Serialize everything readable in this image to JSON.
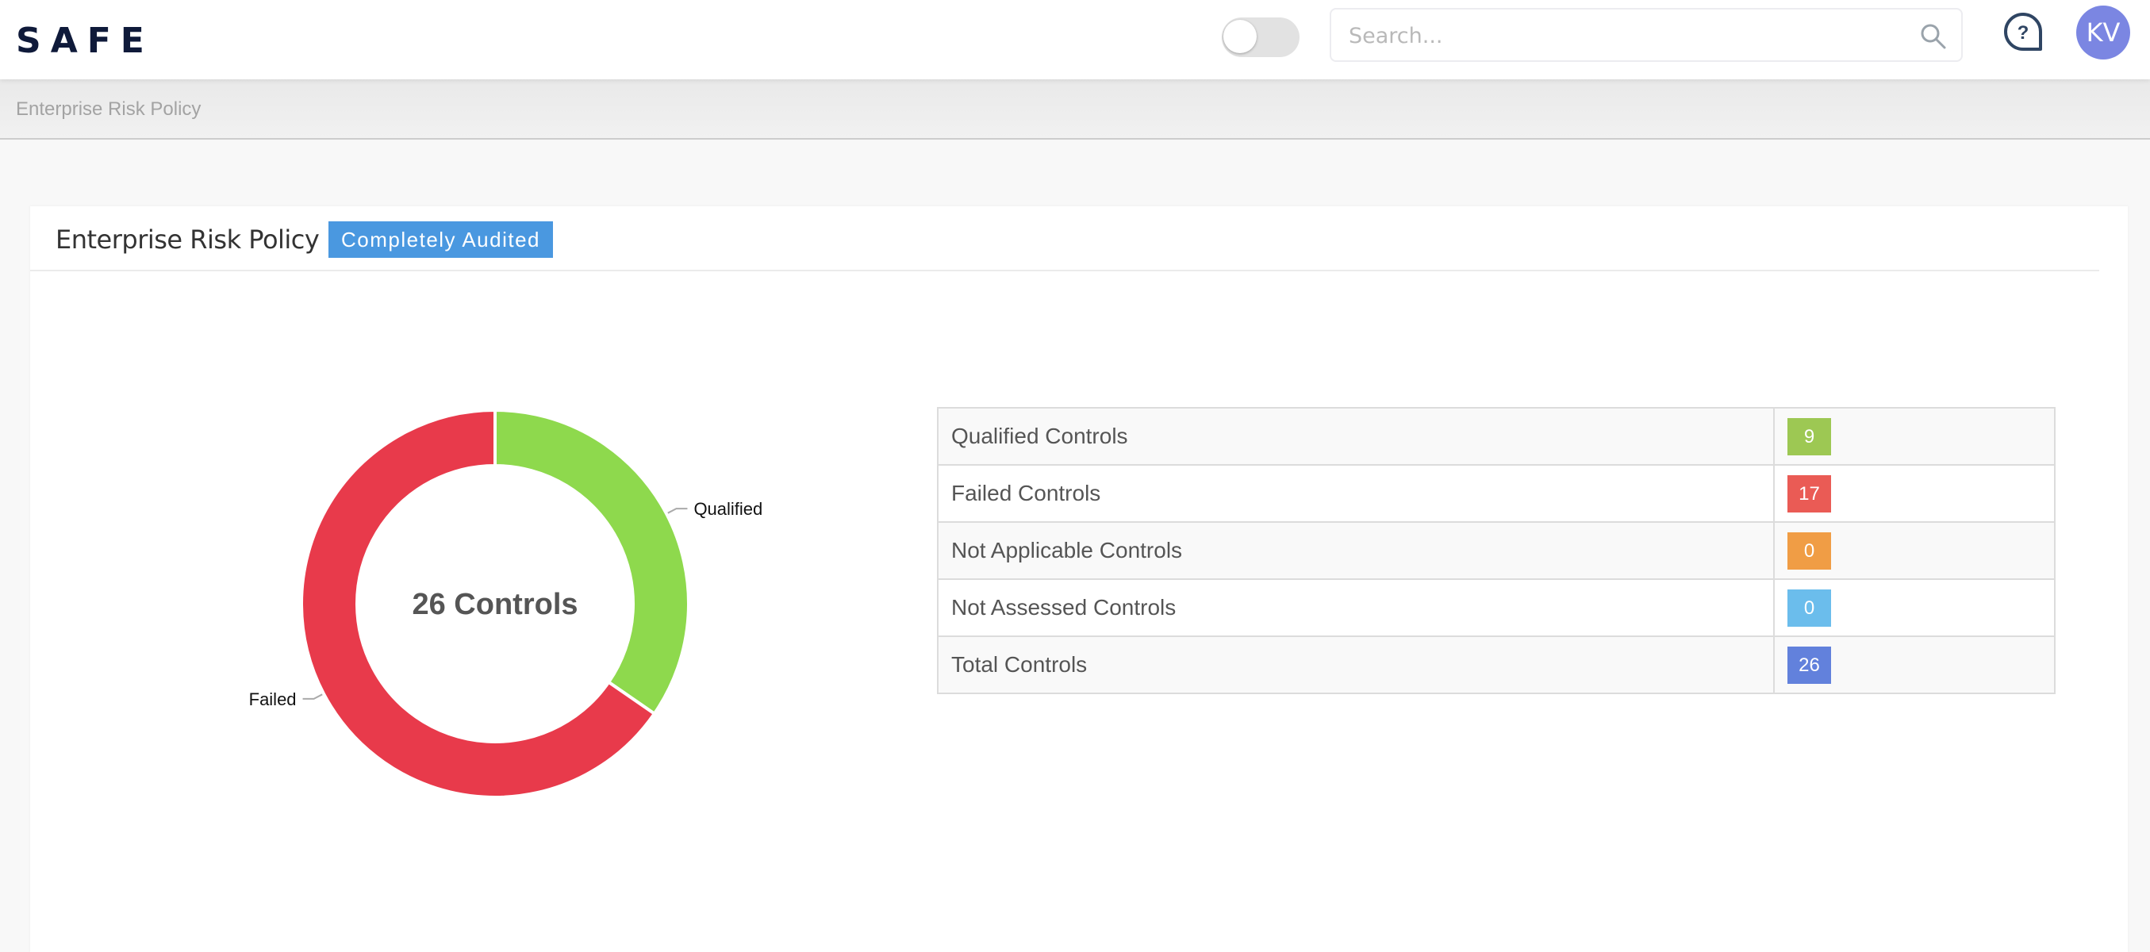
{
  "header": {
    "logo": "SAFE",
    "toggle_on": false,
    "search": {
      "value": "",
      "placeholder": "Search..."
    },
    "help_icon": "help-bubble-icon",
    "avatar_initials": "KV",
    "avatar_color": "#7b86e2"
  },
  "breadcrumb": [
    "Enterprise Risk Policy"
  ],
  "card": {
    "title": "Enterprise Risk Policy",
    "status_badge": "Completely Audited",
    "status_color": "#4a98e0"
  },
  "chart_data": {
    "type": "pie",
    "variant": "donut",
    "center_label": "26 Controls",
    "categories": [
      "Qualified",
      "Failed"
    ],
    "values": [
      9,
      17
    ],
    "colors": [
      "#8ed94d",
      "#e83a4b"
    ],
    "total": 26,
    "legend": "labels-outside"
  },
  "summary_table": {
    "rows": [
      {
        "label": "Qualified Controls",
        "value": "9",
        "color": "#9dc853"
      },
      {
        "label": "Failed Controls",
        "value": "17",
        "color": "#ea5b55"
      },
      {
        "label": "Not Applicable Controls",
        "value": "0",
        "color": "#f09d45"
      },
      {
        "label": "Not Assessed Controls",
        "value": "0",
        "color": "#6bbdec"
      },
      {
        "label": "Total Controls",
        "value": "26",
        "color": "#6281dc"
      }
    ]
  }
}
